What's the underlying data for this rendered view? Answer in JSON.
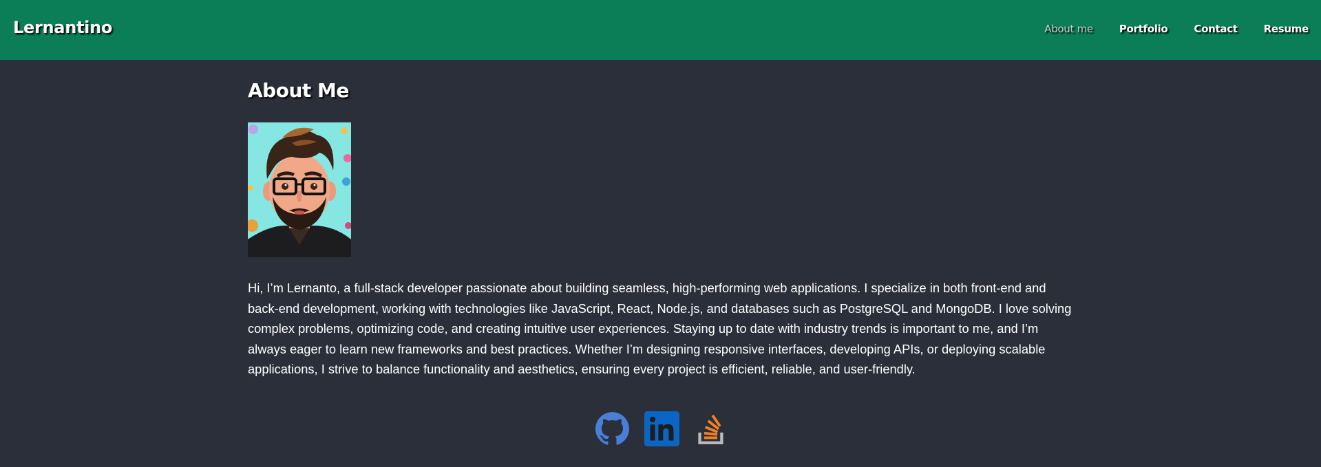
{
  "header": {
    "brand": "Lernantino",
    "nav": [
      {
        "label": "About me",
        "active": true
      },
      {
        "label": "Portfolio",
        "active": false
      },
      {
        "label": "Contact",
        "active": false
      },
      {
        "label": "Resume",
        "active": false
      }
    ],
    "background_color": "#0b7e58"
  },
  "main": {
    "title": "About Me",
    "avatar_icon": "cartoon-avatar-portrait",
    "bio": "Hi, I’m Lernanto, a full-stack developer passionate about building seamless, high-performing web applications. I specialize in both front-end and back-end development, working with technologies like JavaScript, React, Node.js, and databases such as PostgreSQL and MongoDB. I love solving complex problems, optimizing code, and creating intuitive user experiences. Staying up to date with industry trends is important to me, and I’m always eager to learn new frameworks and best practices. Whether I’m designing responsive interfaces, developing APIs, or deploying scalable applications, I strive to balance functionality and aesthetics, ensuring every project is efficient, reliable, and user-friendly."
  },
  "social": [
    {
      "icon": "github-icon",
      "color": "#4a7fd6"
    },
    {
      "icon": "linkedin-icon",
      "color": "#0a66c2"
    },
    {
      "icon": "stackoverflow-icon",
      "color": "#f48024"
    }
  ],
  "page_background": "#2b2f3a"
}
